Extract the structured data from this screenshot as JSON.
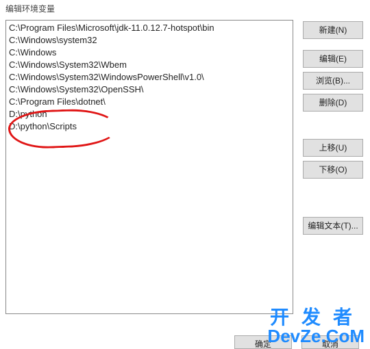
{
  "dialog": {
    "title": "编辑环境变量"
  },
  "list": {
    "items": [
      "C:\\Program Files\\Microsoft\\jdk-11.0.12.7-hotspot\\bin",
      "C:\\Windows\\system32",
      "C:\\Windows",
      "C:\\Windows\\System32\\Wbem",
      "C:\\Windows\\System32\\WindowsPowerShell\\v1.0\\",
      "C:\\Windows\\System32\\OpenSSH\\",
      "C:\\Program Files\\dotnet\\",
      "D:\\python",
      "D:\\python\\Scripts"
    ]
  },
  "buttons": {
    "new": "新建(N)",
    "edit": "编辑(E)",
    "browse": "浏览(B)...",
    "delete": "删除(D)",
    "moveUp": "上移(U)",
    "moveDown": "下移(O)",
    "editText": "编辑文本(T)...",
    "ok": "确定",
    "cancel": "取消"
  },
  "watermark": {
    "line1": "开发者",
    "line2": "DevZe.CoM"
  }
}
